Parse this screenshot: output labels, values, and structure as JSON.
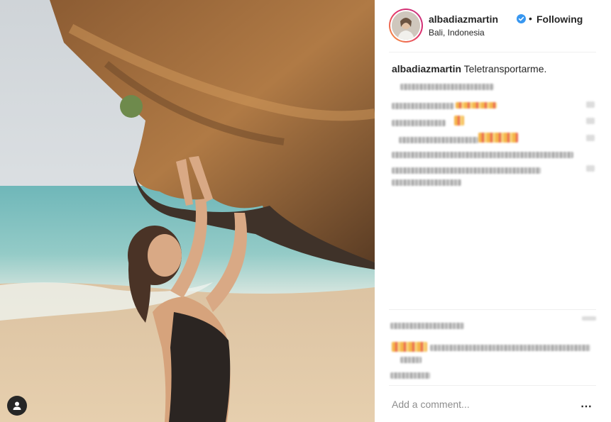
{
  "post": {
    "username": "albadiazmartin",
    "separator": "•",
    "follow_status": "Following",
    "location": "Bali, Indonesia",
    "caption_username": "albadiazmartin",
    "caption_text": "Teletransportarme.",
    "add_comment_placeholder": "Add a comment...",
    "more_icon": "⋯"
  },
  "icons": {
    "verified": "verified-badge-icon",
    "tag": "user-tag-icon",
    "more": "more-options-icon"
  },
  "colors": {
    "verified_blue": "#3897f0",
    "text": "#262626",
    "muted": "#8e8e8e",
    "divider": "#efefef"
  }
}
